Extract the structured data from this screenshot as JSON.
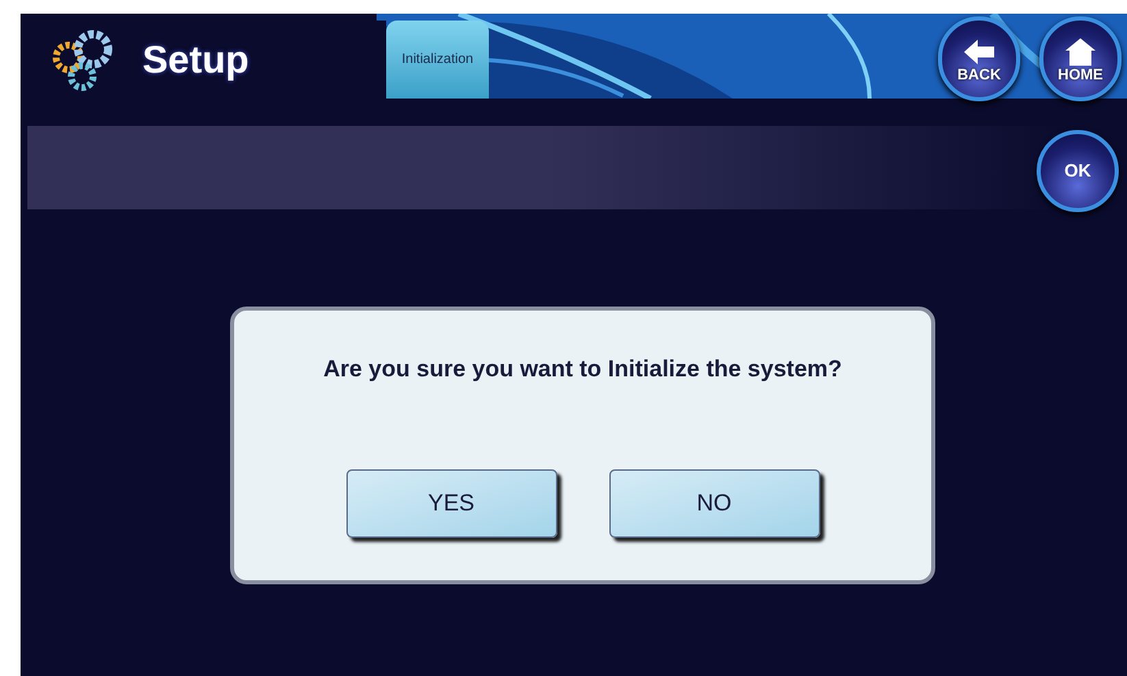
{
  "header": {
    "title": "Setup"
  },
  "tabs": [
    {
      "label": "Initialization",
      "selected": true
    }
  ],
  "nav_buttons": [
    {
      "kind": "back",
      "label": "BACK"
    },
    {
      "kind": "home",
      "label": "HOME"
    }
  ],
  "ok_button": {
    "label": "OK"
  },
  "dialog": {
    "message": "Are you sure you want to Initialize the system?",
    "buttons": [
      "YES",
      "NO"
    ]
  }
}
